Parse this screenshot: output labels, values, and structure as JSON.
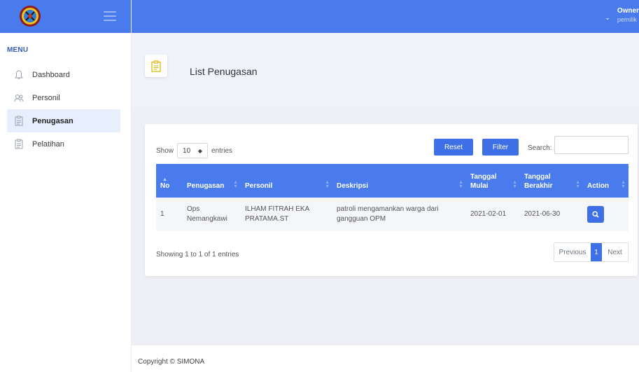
{
  "topbar": {
    "user_name": "Owner",
    "user_role": "pemilik"
  },
  "sidebar": {
    "menu_title": "MENU",
    "items": [
      {
        "label": "Dashboard",
        "icon": "bell-icon"
      },
      {
        "label": "Personil",
        "icon": "users-icon"
      },
      {
        "label": "Penugasan",
        "icon": "clipboard-icon",
        "active": true
      },
      {
        "label": "Pelatihan",
        "icon": "clipboard-icon"
      }
    ]
  },
  "page": {
    "title": "List Penugasan",
    "icon": "clipboard-icon"
  },
  "table_controls": {
    "show_label": "Show",
    "entries_value": "10",
    "entries_label": "entries",
    "reset_label": "Reset",
    "filter_label": "Filter",
    "search_label": "Search:",
    "search_value": ""
  },
  "table": {
    "headers": [
      "No",
      "Penugasan",
      "Personil",
      "Deskripsi",
      "Tanggal Mulai",
      "Tanggal Berakhir",
      "Action"
    ],
    "rows": [
      {
        "no": "1",
        "penugasan": "Ops Nemangkawi",
        "personil": "ILHAM FITRAH EKA PRATAMA.ST",
        "deskripsi": "patroli mengamankan warga dari gangguan OPM",
        "tanggal_mulai": "2021-02-01",
        "tanggal_berakhir": "2021-06-30"
      }
    ]
  },
  "pagination": {
    "info": "Showing 1 to 1 of 1 entries",
    "previous": "Previous",
    "current": "1",
    "next": "Next"
  },
  "footer": {
    "copyright": "Copyright © SIMONA"
  },
  "colors": {
    "primary": "#4a7bec",
    "button": "#3e6fe6",
    "active_bg": "#e7effd"
  }
}
